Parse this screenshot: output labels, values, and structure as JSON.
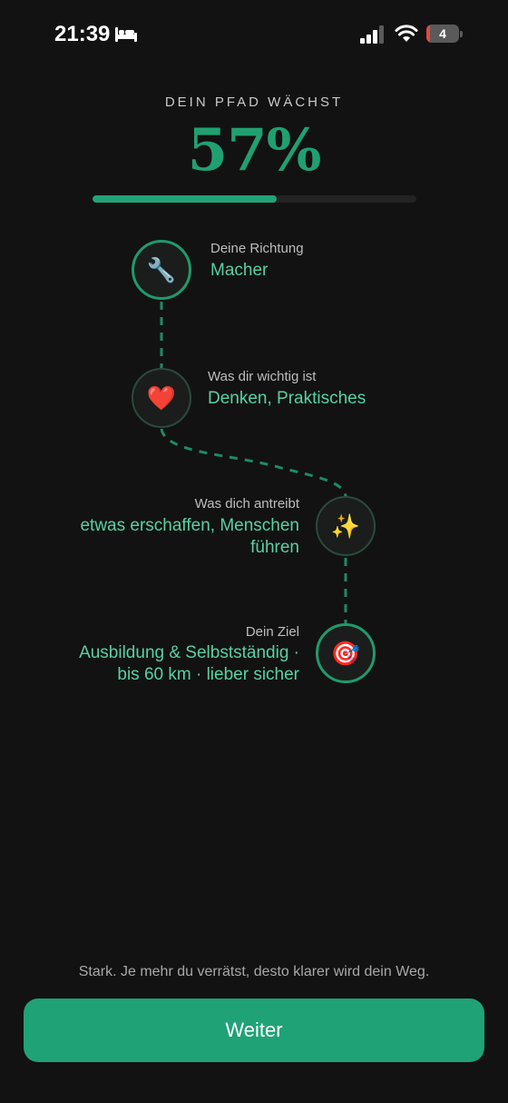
{
  "status_bar": {
    "time": "21:39",
    "battery_level": "4",
    "battery_fraction": 0.12
  },
  "header": {
    "eyebrow": "DEIN PFAD WÄCHST",
    "percent": "57%",
    "progress": 0.57
  },
  "path": {
    "nodes": [
      {
        "icon": "🔧",
        "icon_name": "wrench-icon",
        "label": "Deine Richtung",
        "value": "Macher"
      },
      {
        "icon": "❤️",
        "icon_name": "heart-icon",
        "label": "Was dir wichtig ist",
        "value": "Denken, Praktisches"
      },
      {
        "icon": "✨",
        "icon_name": "sparkles-icon",
        "label": "Was dich antreibt",
        "value_line1": "etwas erschaffen, Menschen",
        "value_line2": "führen"
      },
      {
        "icon": "🎯",
        "icon_name": "target-icon",
        "label": "Dein Ziel",
        "value_line1": "Ausbildung & Selbstständig ·",
        "value_line2": "bis 60 km · lieber sicher"
      }
    ]
  },
  "footer": {
    "note": "Stark. Je mehr du verrätst, desto klarer wird dein Weg.",
    "button_label": "Weiter"
  },
  "colors": {
    "accent": "#1fa276",
    "accent_text": "#58d1a2",
    "background": "#121212"
  }
}
